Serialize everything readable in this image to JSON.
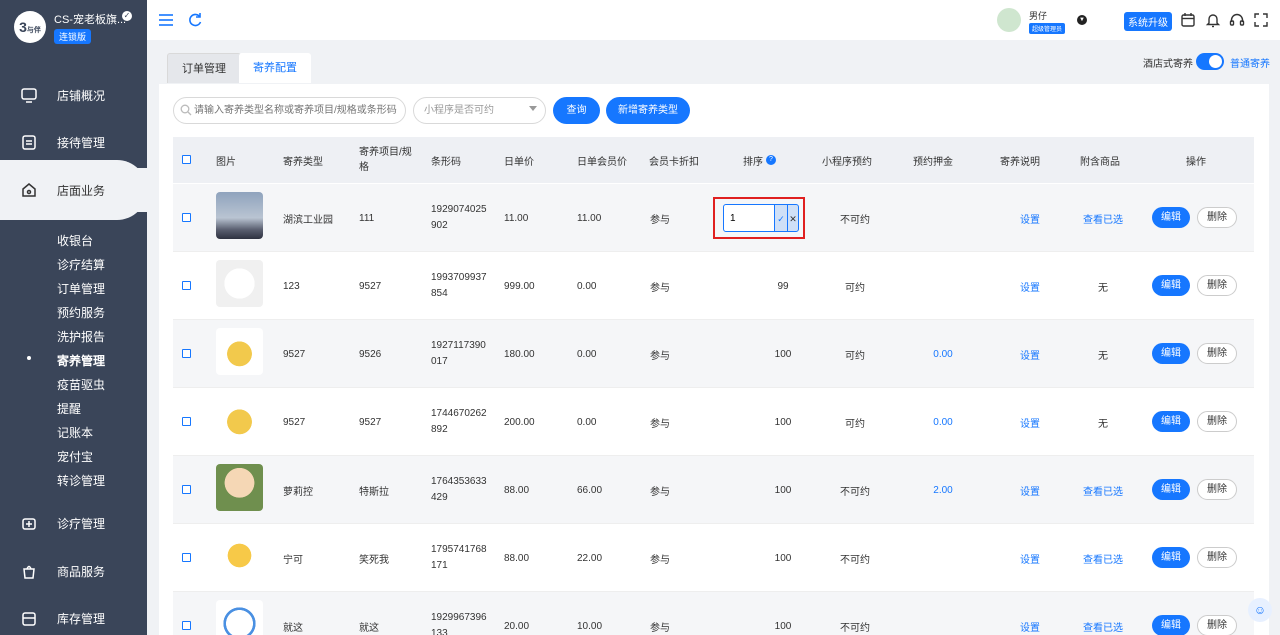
{
  "brand": {
    "name": "CS-宠老板旗...",
    "badge": "连锁版",
    "logo_text": "与伴"
  },
  "sidebar": {
    "items": [
      {
        "label": "店铺概况",
        "icon": "monitor-icon"
      },
      {
        "label": "接待管理",
        "icon": "clipboard-icon"
      },
      {
        "label": "店面业务",
        "icon": "shop-icon"
      },
      {
        "label": "诊疗管理",
        "icon": "medical-icon"
      },
      {
        "label": "商品服务",
        "icon": "bag-icon"
      },
      {
        "label": "库存管理",
        "icon": "warehouse-icon"
      }
    ],
    "sub_items": [
      "收银台",
      "诊疗结算",
      "订单管理",
      "预约服务",
      "洗护报告",
      "寄养管理",
      "疫苗驱虫",
      "提醒",
      "记账本",
      "宠付宝",
      "转诊管理"
    ]
  },
  "topbar": {
    "user_name": "男仔",
    "user_role": "超级管理员",
    "upgrade_label": "系统升级"
  },
  "tabs": [
    "订单管理",
    "寄养配置"
  ],
  "mode": {
    "left_label": "酒店式寄养",
    "right_label": "普通寄养"
  },
  "filters": {
    "search_placeholder": "请输入寄养类型名称或寄养项目/规格或条形码",
    "select_placeholder": "小程序是否可约",
    "query_label": "查询",
    "add_label": "新增寄养类型"
  },
  "table": {
    "headers": [
      "图片",
      "寄养类型",
      "寄养项目/规格",
      "条形码",
      "日单价",
      "日单会员价",
      "会员卡折扣",
      "排序",
      "小程序预约",
      "预约押金",
      "寄养说明",
      "附含商品",
      "操作"
    ],
    "rows": [
      {
        "type": "湖滨工业园",
        "item": "111",
        "barcode": "1929074025 902",
        "price": "11.00",
        "member_price": "11.00",
        "discount": "参与",
        "sort": "1",
        "booking": "不可约",
        "deposit": "",
        "desc": "设置",
        "goods": "查看已选"
      },
      {
        "type": "123",
        "item": "9527",
        "barcode": "1993709937 854",
        "price": "999.00",
        "member_price": "0.00",
        "discount": "参与",
        "sort": "99",
        "booking": "可约",
        "deposit": "",
        "desc": "设置",
        "goods": "无"
      },
      {
        "type": "9527",
        "item": "9526",
        "barcode": "1927117390 017",
        "price": "180.00",
        "member_price": "0.00",
        "discount": "参与",
        "sort": "100",
        "booking": "可约",
        "deposit": "0.00",
        "desc": "设置",
        "goods": "无"
      },
      {
        "type": "9527",
        "item": "9527",
        "barcode": "1744670262 892",
        "price": "200.00",
        "member_price": "0.00",
        "discount": "参与",
        "sort": "100",
        "booking": "可约",
        "deposit": "0.00",
        "desc": "设置",
        "goods": "无"
      },
      {
        "type": "萝莉控",
        "item": "特斯拉",
        "barcode": "1764353633 429",
        "price": "88.00",
        "member_price": "66.00",
        "discount": "参与",
        "sort": "100",
        "booking": "不可约",
        "deposit": "2.00",
        "desc": "设置",
        "goods": "查看已选"
      },
      {
        "type": "宁可",
        "item": "笑死我",
        "barcode": "1795741768 171",
        "price": "88.00",
        "member_price": "22.00",
        "discount": "参与",
        "sort": "100",
        "booking": "不可约",
        "deposit": "",
        "desc": "设置",
        "goods": "查看已选"
      },
      {
        "type": "就这",
        "item": "就这",
        "barcode": "1929967396 133",
        "price": "20.00",
        "member_price": "10.00",
        "discount": "参与",
        "sort": "100",
        "booking": "不可约",
        "deposit": "",
        "desc": "设置",
        "goods": "查看已选"
      }
    ],
    "edit_label": "编辑",
    "delete_label": "删除"
  },
  "colors": {
    "accent": "#1677ff",
    "sidebar": "#3a4559",
    "highlight": "#e02020"
  }
}
